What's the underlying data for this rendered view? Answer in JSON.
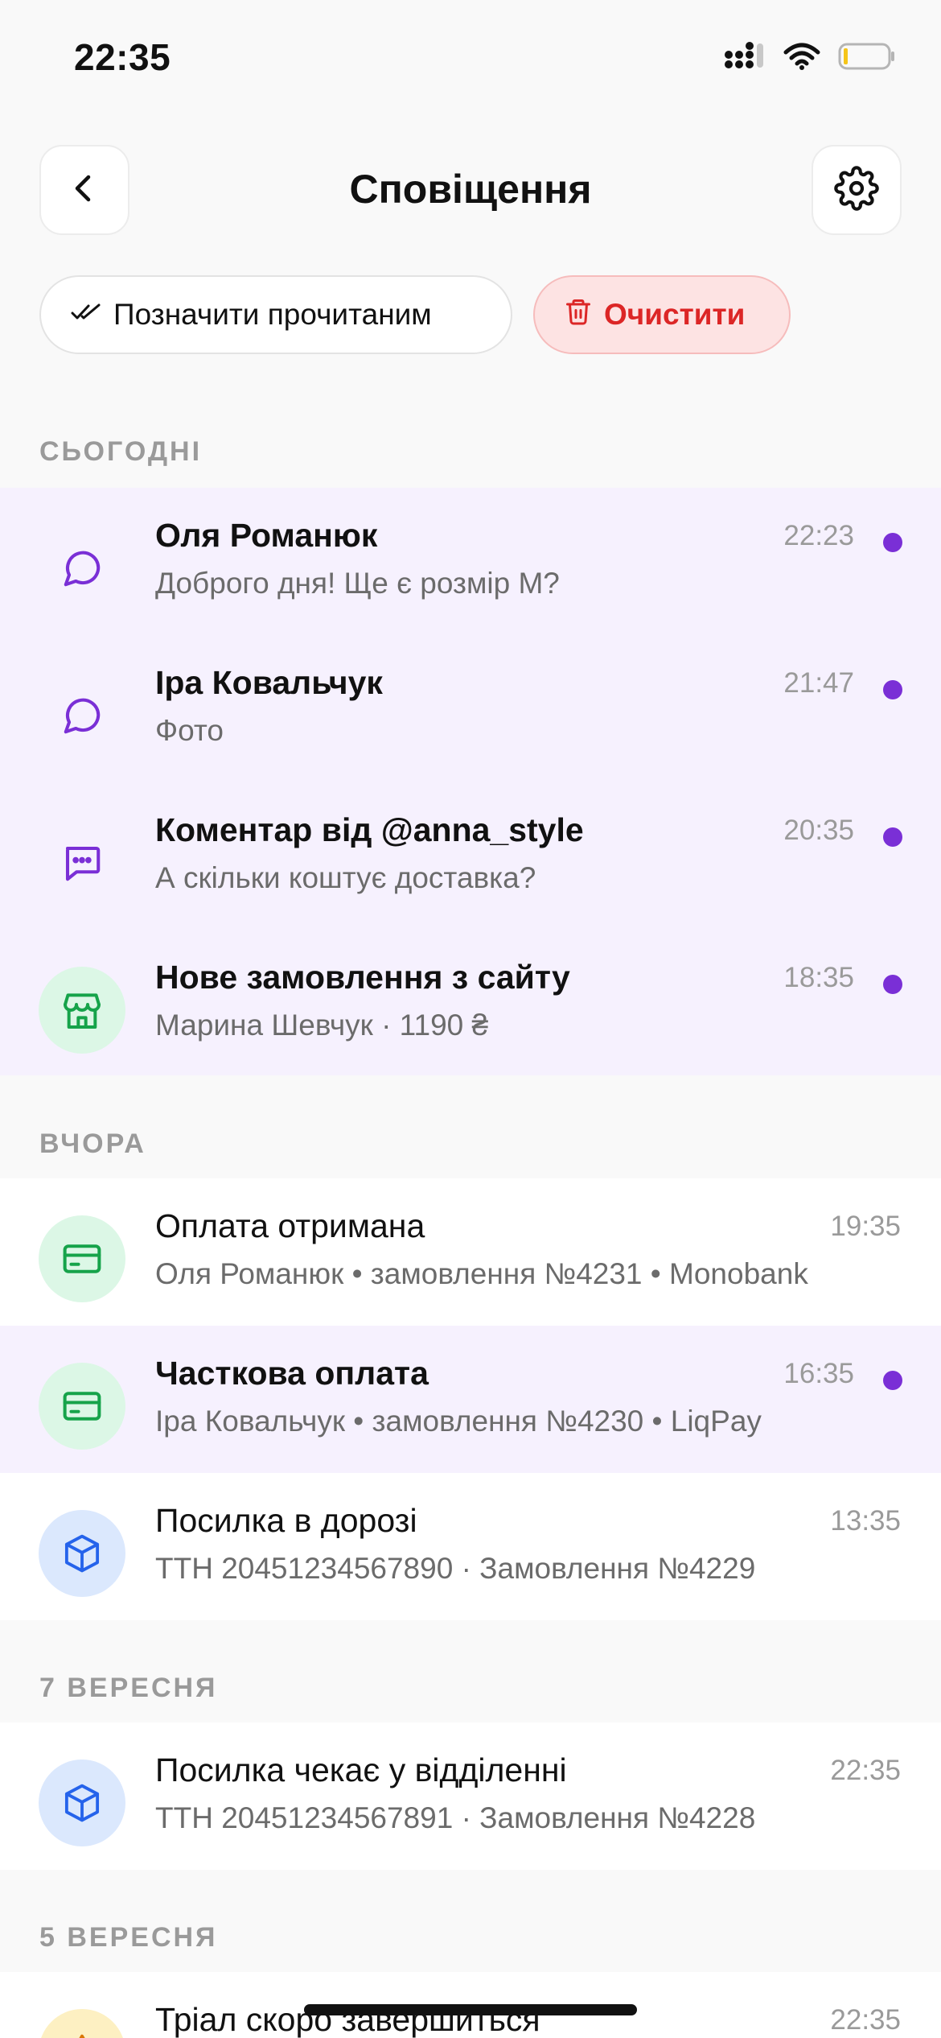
{
  "status_bar": {
    "time": "22:35"
  },
  "header": {
    "title": "Сповіщення"
  },
  "actions": {
    "mark_read_label": "Позначити прочитаним",
    "clear_label": "Очистити"
  },
  "sections": {
    "today": "СЬОГОДНІ",
    "yesterday": "ВЧОРА",
    "sep7": "7 ВЕРЕСНЯ",
    "sep5": "5 ВЕРЕСНЯ"
  },
  "notifications": [
    {
      "title": "Оля Романюк",
      "subtitle": "Доброго дня! Ще є розмір М?",
      "time": "22:23",
      "unread": true,
      "icon": "chat-bubble-icon"
    },
    {
      "title": "Іра Ковальчук",
      "subtitle": "Фото",
      "time": "21:47",
      "unread": true,
      "icon": "chat-bubble-icon"
    },
    {
      "title": "Коментар від @anna_style",
      "subtitle": "А скільки коштує доставка?",
      "time": "20:35",
      "unread": true,
      "icon": "comment-icon"
    },
    {
      "title": "Нове замовлення з сайту",
      "subtitle": "Марина Шевчук · 1190 ₴",
      "time": "18:35",
      "unread": true,
      "icon": "store-icon"
    },
    {
      "title": "Оплата отримана",
      "subtitle": "Оля Романюк • замовлення №4231 • Monobank",
      "time": "19:35",
      "unread": false,
      "icon": "card-icon"
    },
    {
      "title": "Часткова оплата",
      "subtitle": "Іра Ковальчук • замовлення №4230 • LiqPay",
      "time": "16:35",
      "unread": true,
      "icon": "card-icon"
    },
    {
      "title": "Посилка в дорозі",
      "subtitle": "ТТН 20451234567890 · Замовлення №4229",
      "time": "13:35",
      "unread": false,
      "icon": "package-icon"
    },
    {
      "title": "Посилка чекає у відділенні",
      "subtitle": "ТТН 20451234567891 · Замовлення №4228",
      "time": "22:35",
      "unread": false,
      "icon": "package-icon"
    },
    {
      "title": "Тріал скоро завершиться",
      "subtitle": "",
      "time": "22:35",
      "unread": false,
      "icon": "warning-icon"
    }
  ],
  "colors": {
    "accent": "#7a2fd6",
    "unread_bg": "#f6f1fe",
    "danger": "#dc2626",
    "success": "#16a34a",
    "info": "#2563eb"
  }
}
